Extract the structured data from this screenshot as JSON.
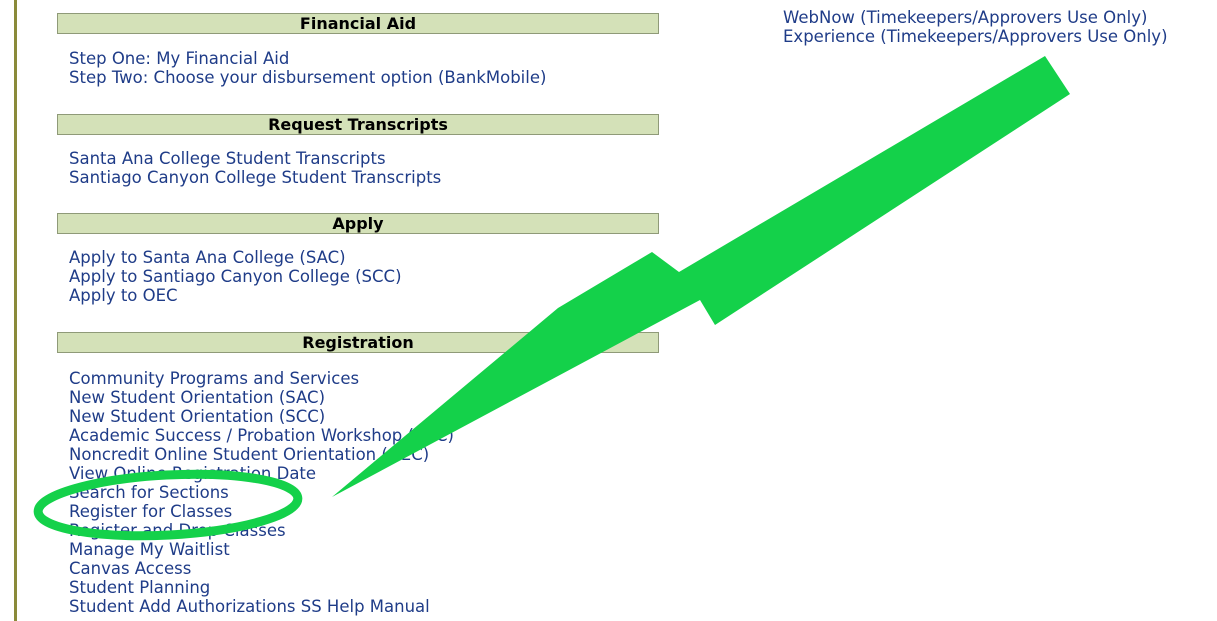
{
  "right_links": [
    "WebNow (Timekeepers/Approvers Use Only)",
    "Experience (Timekeepers/Approvers Use Only)"
  ],
  "sections": [
    {
      "title": "Financial Aid",
      "links": [
        "Step One: My Financial Aid",
        "Step Two: Choose your disbursement option (BankMobile)"
      ]
    },
    {
      "title": "Request Transcripts",
      "links": [
        "Santa Ana College Student Transcripts",
        "Santiago Canyon College Student Transcripts"
      ]
    },
    {
      "title": "Apply",
      "links": [
        "Apply to Santa Ana College (SAC)",
        "Apply to Santiago Canyon College (SCC)",
        "Apply to OEC"
      ]
    },
    {
      "title": "Registration",
      "links": [
        "Community Programs and Services",
        "New Student Orientation (SAC)",
        "New Student Orientation (SCC)",
        "Academic Success / Probation Workshop (SCC)",
        "Noncredit Online Student Orientation (OEC)",
        "View Online Registration Date",
        "Search for Sections",
        "Register for Classes",
        "Register and Drop Classes",
        "Manage My Waitlist",
        "Canvas Access",
        "Student Planning",
        "Student Add Authorizations SS Help Manual"
      ]
    }
  ],
  "colors": {
    "header_bg": "#d4e1b8",
    "link": "#1f3c88",
    "annotation_green": "#14d14a"
  },
  "annotation": {
    "arrow_icon": "green-arrow-icon",
    "highlight_icon": "green-ellipse-icon"
  }
}
